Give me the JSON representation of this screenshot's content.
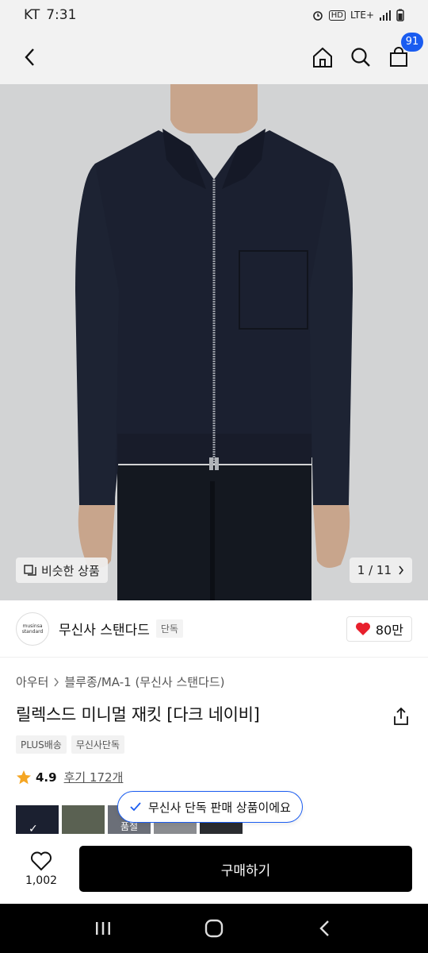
{
  "status_bar": {
    "carrier": "KT",
    "time": "7:31",
    "network": "LTE+",
    "hd": "HD"
  },
  "top_nav": {
    "cart_count": "91"
  },
  "hero": {
    "similar_label": "비슷한 상품",
    "page_counter": "1 / 11"
  },
  "brand": {
    "logo_line1": "musinsa",
    "logo_line2": "standard",
    "name": "무신사 스탠다드",
    "tag": "단독",
    "likes": "80만"
  },
  "product": {
    "breadcrumb": [
      "아우터",
      "블루종/MA-1 (무신사 스탠다드)"
    ],
    "title": "릴렉스드 미니멀 재킷 [다크 네이비]",
    "tags": [
      "PLUS배송",
      "무신사단독"
    ],
    "rating": "4.9",
    "reviews": "후기 172개"
  },
  "swatches": {
    "sold_out_label": "품절"
  },
  "toast": {
    "text": "무신사 단독 판매 상품이에요"
  },
  "bottom_bar": {
    "wish_count": "1,002",
    "buy_label": "구매하기"
  },
  "colors": {
    "accent": "#1a5cf0",
    "heart": "#e8202c",
    "star": "#f5a623",
    "jacket": "#1b2030",
    "hero_bg": "#d2d3d4"
  }
}
